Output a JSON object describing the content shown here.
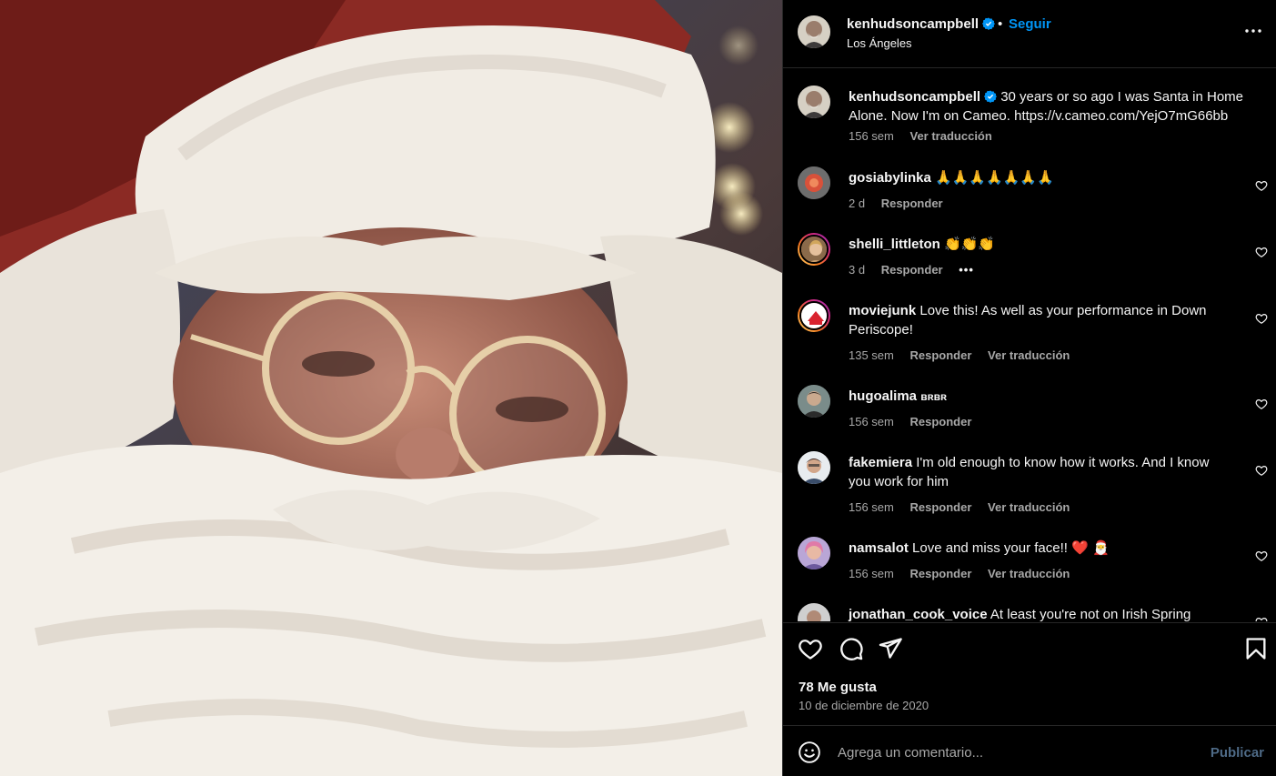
{
  "post": {
    "username": "kenhudsoncampbell",
    "follow_label": "Seguir",
    "separator": "•",
    "location": "Los Ángeles",
    "caption": "30 years or so ago I was Santa in Home Alone. Now I'm on Cameo. https://v.cameo.com/YejO7mG66bb",
    "caption_age": "156 sem",
    "caption_translate": "Ver traducción",
    "likes_label": "78 Me gusta",
    "date": "10 de diciembre de 2020"
  },
  "comments": [
    {
      "username": "gosiabylinka",
      "text": "🙏🙏🙏🙏🙏🙏🙏",
      "age": "2 d",
      "reply": "Responder",
      "translate": "",
      "extra": ""
    },
    {
      "username": "shelli_littleton",
      "text": "👏👏👏",
      "age": "3 d",
      "reply": "Responder",
      "translate": "",
      "extra": "•••"
    },
    {
      "username": "moviejunk",
      "text": "Love this! As well as your performance in Down Periscope!",
      "age": "135 sem",
      "reply": "Responder",
      "translate": "Ver traducción",
      "extra": ""
    },
    {
      "username": "hugoalima",
      "text": "ʙʀʙʀ",
      "age": "156 sem",
      "reply": "Responder",
      "translate": "",
      "extra": ""
    },
    {
      "username": "fakemiera",
      "text": "I'm old enough to know how it works. And I know you work for him",
      "age": "156 sem",
      "reply": "Responder",
      "translate": "Ver traducción",
      "extra": ""
    },
    {
      "username": "namsalot",
      "text": "Love and miss your face!! ❤️ 🎅",
      "age": "156 sem",
      "reply": "Responder",
      "translate": "Ver traducción",
      "extra": ""
    },
    {
      "username": "jonathan_cook_voice",
      "text": "At least you're not on Irish Spring",
      "age": "",
      "reply": "",
      "translate": "",
      "extra": ""
    }
  ],
  "composer": {
    "placeholder": "Agrega un comentario...",
    "publish_label": "Publicar"
  },
  "icons": {
    "more": "more-options-icon",
    "like": "heart-icon",
    "comment": "comment-icon",
    "share": "send-icon",
    "save": "bookmark-icon",
    "emoji": "emoji-icon",
    "verified": "verified-badge-icon"
  },
  "colors": {
    "accent": "#0095f6",
    "verified": "#0095f6",
    "publish_disabled": "#4e6a86",
    "secondary_text": "#a8a8a8"
  }
}
